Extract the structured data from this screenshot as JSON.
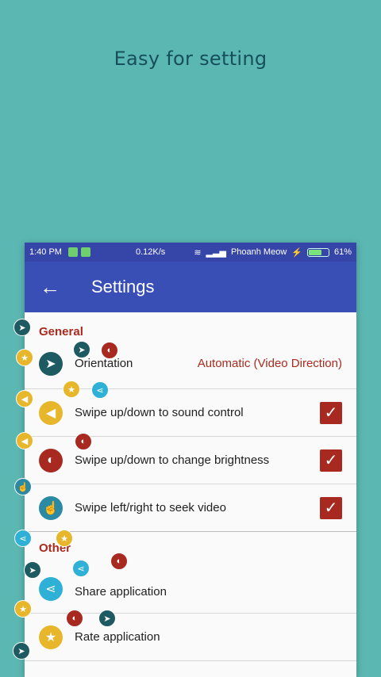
{
  "headline": "Easy for setting",
  "status_bar": {
    "time": "1:40 PM",
    "speed": "0.12K/s",
    "carrier": "Phoanh Meow",
    "battery_pct": "61%",
    "battery_level": 0.61,
    "colors": {
      "background": "#3545a8"
    }
  },
  "app_bar": {
    "back_icon": "arrow-left",
    "title": "Settings",
    "colors": {
      "background": "#3a4fb5"
    }
  },
  "sections": {
    "general": "General",
    "other": "Other"
  },
  "settings": {
    "orientation": {
      "label": "Orientation",
      "value": "Automatic (Video Direction)",
      "icon": "navigation-arrow"
    },
    "sound": {
      "label": "Swipe up/down to sound control",
      "checked": true,
      "icon": "volume"
    },
    "brightness": {
      "label": "Swipe up/down to change brightness",
      "checked": true,
      "icon": "brightness"
    },
    "seek": {
      "label": "Swipe left/right to seek video",
      "checked": true,
      "icon": "touch"
    },
    "share": {
      "label": "Share application",
      "icon": "share"
    },
    "rate": {
      "label": "Rate application",
      "icon": "star"
    }
  },
  "accent_colors": {
    "section_text": "#a92a1e",
    "checkbox": "#a7291f",
    "teal_background": "#5bb7b2"
  }
}
